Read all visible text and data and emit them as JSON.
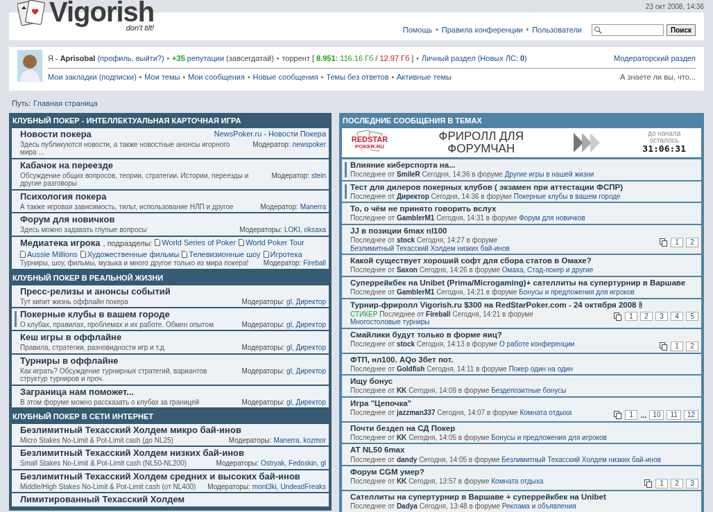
{
  "date": "23 окт 2008, 14:36",
  "logo": {
    "name": "Vigorish",
    "tagline": "don't tilt!"
  },
  "top_links": [
    "Помощь",
    "Правила конференции",
    "Пользователи"
  ],
  "separator": "•",
  "search": {
    "button": "Поиск"
  },
  "user_panel": {
    "groups": [
      [
        {
          "kind": "plain",
          "text": "Я -"
        },
        {
          "kind": "bold",
          "text": "Aprisobal"
        },
        {
          "kind": "link",
          "text": "(профиль, выйти?)"
        }
      ],
      [
        {
          "kind": "greenbold",
          "text": "+35"
        },
        {
          "kind": "link",
          "text": "репутации"
        },
        {
          "kind": "plain",
          "text": "(завсегдатай)"
        }
      ],
      [
        {
          "kind": "plain",
          "text": "торрент"
        },
        {
          "kind": "plain",
          "text": "["
        },
        {
          "kind": "greenbold",
          "text": "8.951:"
        },
        {
          "kind": "green",
          "text": "116.16 Гб"
        },
        {
          "kind": "plain",
          "text": "/"
        },
        {
          "kind": "red",
          "text": "12.97 Гб"
        },
        {
          "kind": "plain",
          "text": "]"
        }
      ],
      [
        {
          "kind": "link",
          "text": "Личный раздел (Новых ЛС: **0**)"
        }
      ]
    ],
    "moderator_link": "Модераторский раздел",
    "nav": [
      "Мои закладки (подписки)",
      "Мои темы",
      "Мои сообщения",
      "Новые сообщения",
      "Темы без ответов",
      "Активные темы"
    ],
    "tip": "А знаете ли вы, что..."
  },
  "path": {
    "label": "Путь:",
    "link": "Главная страница"
  },
  "sections": [
    {
      "title": "КЛУБНЫЙ ПОКЕР - ИНТЕЛЛЕКТУАЛЬНАЯ КАРТОЧНАЯ ИГРА",
      "forums": [
        {
          "kind": "forum",
          "unread": false,
          "title": "Новости покера",
          "extra_link": "NewsPoker.ru - Новости Покера",
          "description": "Здесь публикуются новости, а также новостные анонсы игорного мира ...",
          "mod_label": "Модератор:",
          "moderators": "newspoker"
        },
        {
          "kind": "forum",
          "unread": false,
          "title": "Кабачок на переезде",
          "description": "Обсуждение общих вопросов, теории, стратегии. Истории, переезды и другие разговоры",
          "mod_label": "Модератор:",
          "moderators": "stein"
        },
        {
          "kind": "forum",
          "unread": false,
          "title": "Психология покера",
          "description": "А также игровая зависимость, тильт, использование НЛП и другое",
          "mod_label": "Модератор:",
          "moderators": "Manerra"
        },
        {
          "kind": "forum",
          "unread": false,
          "title": "Форум для новичков",
          "description": "Здесь можно задавать глупые вопросы",
          "mod_label": "Модераторы:",
          "moderators": "LOKI, oksaxa"
        },
        {
          "kind": "media",
          "unread": false,
          "title": "Медиатека игрока",
          "subforums_label": ", подразделы:",
          "subforums": [
            "World Series of Poker",
            "World Poker Tour",
            "Aussie Millions",
            "Художественные фильмы",
            "Телевизионные шоу",
            "Игротека"
          ],
          "description": "Турниры, шоу, фильмы, музыка и много другое только из мира покера!",
          "mod_label": "Модератор:",
          "moderators": "Fireball"
        }
      ]
    },
    {
      "title": "КЛУБНЫЙ ПОКЕР В РЕАЛЬНОЙ ЖИЗНИ",
      "forums": [
        {
          "kind": "forum",
          "unread": false,
          "title": "Пресс-релизы и анонсы событий",
          "description": "Тут кипит жизнь оффлайн покера",
          "mod_label": "Модераторы:",
          "moderators": "gl, Директор"
        },
        {
          "kind": "forum",
          "unread": true,
          "title": "Покерные клубы в вашем городе",
          "description": "О клубах, правилах, проблемах и их работе. Обмен опытом",
          "mod_label": "Модераторы:",
          "moderators": "gl, Директор"
        },
        {
          "kind": "forum",
          "unread": false,
          "title": "Кеш игры в оффлайне",
          "description": "Правила, стратегии, разновидности игр и т.д.",
          "mod_label": "Модераторы:",
          "moderators": "gl, Директор"
        },
        {
          "kind": "forum",
          "unread": false,
          "title": "Турниры в оффлайне",
          "description": "Как играть? Обсуждение турнирных стратегий, вариантов структур турниров и проч.",
          "mod_label": "Модераторы:",
          "moderators": "gl, Директор"
        },
        {
          "kind": "forum",
          "unread": false,
          "title": "Заграница нам поможет...",
          "description": "В этом форуме можно рассказать о клубах за границей",
          "mod_label": "Модераторы:",
          "moderators": "gl, Директор"
        }
      ]
    },
    {
      "title": "КЛУБНЫЙ ПОКЕР В СЕТИ ИНТЕРНЕТ",
      "forums": [
        {
          "kind": "forum",
          "unread": false,
          "title": "Безлимитный Техасский Холдем микро бай-инов",
          "description": "Micro Stakes No-Limit & Pot-Limit cash (до NL25)",
          "mod_label": "Модераторы:",
          "moderators": "Manerra, kozmor"
        },
        {
          "kind": "forum",
          "unread": false,
          "title": "Безлимитный Техасский Холдем низких бай-инов",
          "description": "Small Stakes No-Limit & Pot-Limit cash (NL50-NL200)",
          "mod_label": "Модераторы:",
          "moderators": "Ostryak, Fedoskin, gl"
        },
        {
          "kind": "forum",
          "unread": false,
          "title": "Безлимитный Техасский Холдем средних и высоких бай-инов",
          "description": "Middle/High Stakes No-Limit & Pot-Limit cash (от NL400)",
          "mod_label": "Модераторы:",
          "moderators": "mont3ki, UndeadFreaks"
        },
        {
          "kind": "forum",
          "unread": false,
          "title": "Лимитированный Техасский Холдем"
        }
      ]
    }
  ],
  "recent": {
    "title": "ПОСЛЕДНИЕ СООБЩЕНИЯ В ТЕМАХ",
    "banner": {
      "logo_top": "REDSTAR",
      "logo_bottom": "POKER.RU",
      "headline": "ФРИРОЛЛ ДЛЯ ФОРУМЧАН",
      "countdown_label": "до начала осталось",
      "countdown": "31:06:31"
    },
    "topics": [
      {
        "unread": true,
        "attachment": false,
        "title": "Влияние киберспорта на...",
        "last_by": "Последнее от",
        "author": "SmileR",
        "time": "Сегодня, 14:36",
        "in_forum": "в форуме",
        "forum": "Другие игры в нашей жизни"
      },
      {
        "unread": true,
        "attachment": false,
        "title": "Тест для дилеров покерных клубов ( экзамен при аттестации ФСПР)",
        "last_by": "Последнее от",
        "author": "Директор",
        "time": "Сегодня, 14:36",
        "in_forum": "в форуме",
        "forum": "Покерные клубы в вашем городе"
      },
      {
        "unread": false,
        "attachment": false,
        "title": "То, о чём не принято говорить вслух",
        "last_by": "Последнее от",
        "author": "GamblerM1",
        "time": "Сегодня, 14:31",
        "in_forum": "в форуме",
        "forum": "Форум для новичков"
      },
      {
        "unread": false,
        "attachment": false,
        "title": "JJ в позиции 6max nl100",
        "last_by": "Последнее от",
        "author": "stock",
        "time": "Сегодня, 14:27",
        "in_forum": "в форуме",
        "forum": "Безлимитный Техасский Холдем низких бай-инов",
        "pages": [
          {
            "kind": "page",
            "label": "1"
          },
          {
            "kind": "page",
            "label": "2"
          }
        ]
      },
      {
        "unread": false,
        "attachment": false,
        "title": "Какой существует хороший софт для сбора статов в Омахе?",
        "last_by": "Последнее от",
        "author": "Saxon",
        "time": "Сегодня, 14:26",
        "in_forum": "в форуме",
        "forum": "Омаха, Стад-покер и другие"
      },
      {
        "unread": false,
        "attachment": false,
        "title": "Суперрейкбек на Unibet (Prima/Microgaming)+ сателлиты на супертурнир в Варшаве",
        "last_by": "Последнее от",
        "author": "GamblerM1",
        "time": "Сегодня, 14:21",
        "in_forum": "в форуме",
        "forum": "Бонусы и предложения для игроков"
      },
      {
        "unread": false,
        "attachment": true,
        "title": "Турнир-фриролл Vigorish.ru $300 на RedStarPoker.com - 24 октября 2008",
        "tag": "СТИКЕР",
        "last_by": "Последнее от",
        "author": "Fireball",
        "time": "Сегодня, 14:21",
        "in_forum": "в форуме",
        "forum": "Многостоловые турниры",
        "pages": [
          {
            "kind": "page",
            "label": "1"
          },
          {
            "kind": "page",
            "label": "2"
          },
          {
            "kind": "page",
            "label": "3"
          },
          {
            "kind": "page",
            "label": "4"
          },
          {
            "kind": "page",
            "label": "5"
          }
        ]
      },
      {
        "unread": false,
        "attachment": false,
        "title": "Смайлики будут только в форме яиц?",
        "last_by": "Последнее от",
        "author": "stock",
        "time": "Сегодня, 14:13",
        "in_forum": "в форуме",
        "forum": "О работе конференции",
        "pages": [
          {
            "kind": "page",
            "label": "1"
          },
          {
            "kind": "page",
            "label": "2"
          }
        ]
      },
      {
        "unread": false,
        "attachment": false,
        "title": "ФТП, нл100. AQo 3бет пот.",
        "last_by": "Последнее от",
        "author": "Goldfish",
        "time": "Сегодня, 14:11",
        "in_forum": "в форуме",
        "forum": "Покер один на один"
      },
      {
        "unread": false,
        "attachment": false,
        "title": "Ищу бонус",
        "last_by": "Последнее от",
        "author": "KK",
        "time": "Сегодня, 14:09",
        "in_forum": "в форуме",
        "forum": "Бездепозитные бонусы"
      },
      {
        "unread": false,
        "attachment": false,
        "title": "Игра \"Цепочка\"",
        "last_by": "Последнее от",
        "author": "jazzman337",
        "time": "Сегодня, 14:07",
        "in_forum": "в форуме",
        "forum": "Комната отдыха",
        "pages": [
          {
            "kind": "page",
            "label": "1"
          },
          {
            "kind": "gap",
            "label": "..."
          },
          {
            "kind": "page",
            "label": "10"
          },
          {
            "kind": "page",
            "label": "11"
          },
          {
            "kind": "page",
            "label": "12"
          }
        ]
      },
      {
        "unread": false,
        "attachment": false,
        "title": "Почти бездеп на СД Покер",
        "last_by": "Последнее от",
        "author": "KK",
        "time": "Сегодня, 14:05",
        "in_forum": "в форуме",
        "forum": "Бонусы и предложения для игроков"
      },
      {
        "unread": false,
        "attachment": false,
        "title": "AT NL50 6max",
        "last_by": "Последнее от",
        "author": "dandy",
        "time": "Сегодня, 14:05",
        "in_forum": "в форуме",
        "forum": "Безлимитный Техасский Холдем низких бай-инов"
      },
      {
        "unread": false,
        "attachment": false,
        "title": "Форум CGM умер?",
        "last_by": "Последнее от",
        "author": "KK",
        "time": "Сегодня, 13:57",
        "in_forum": "в форуме",
        "forum": "Комната отдыха",
        "pages": [
          {
            "kind": "page",
            "label": "1"
          },
          {
            "kind": "page",
            "label": "2"
          },
          {
            "kind": "page",
            "label": "3"
          }
        ]
      },
      {
        "unread": false,
        "attachment": false,
        "title": "Сателлиты на супертурнир в Варшаве + суперрейкбек на Unibet",
        "last_by": "Последнее от",
        "author": "Dadya",
        "time": "Сегодня, 13:48",
        "in_forum": "в форуме",
        "forum": "Реклама и объявления"
      }
    ]
  }
}
